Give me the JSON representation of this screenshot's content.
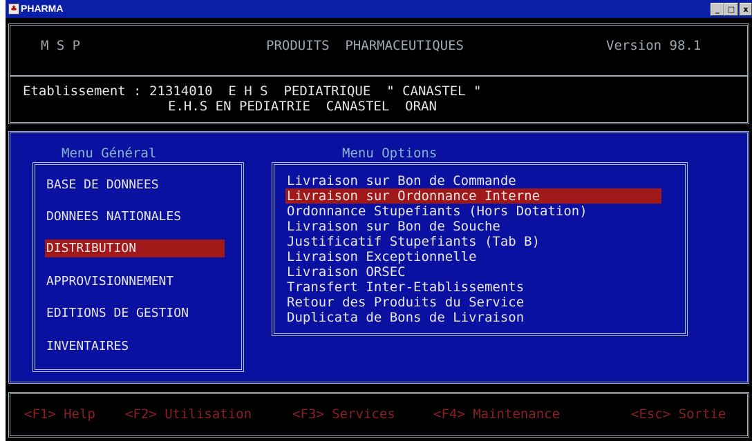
{
  "window": {
    "title": "PHARMA",
    "minimize": "_",
    "maximize": "□",
    "close": "x"
  },
  "header": {
    "org": "M S P",
    "product": "PRODUITS  PHARMACEUTIQUES",
    "version": "Version 98.1",
    "establishment_line1": "Etablissement : 21314010  E H S  PEDIATRIQUE  \" CANASTEL \"",
    "establishment_line2": "E.H.S EN PEDIATRIE  CANASTEL  ORAN"
  },
  "menu_general": {
    "title": "Menu Général",
    "items": [
      {
        "label": "BASE DE DONNEES",
        "selected": false
      },
      {
        "label": "DONNEES NATIONALES",
        "selected": false
      },
      {
        "label": "DISTRIBUTION",
        "selected": true
      },
      {
        "label": "APPROVISIONNEMENT",
        "selected": false
      },
      {
        "label": "EDITIONS DE GESTION",
        "selected": false
      },
      {
        "label": "INVENTAIRES",
        "selected": false
      }
    ]
  },
  "menu_options": {
    "title": "Menu Options",
    "items": [
      {
        "label": "Livraison sur Bon de Commande",
        "selected": false
      },
      {
        "label": "Livraison sur Ordonnance Interne",
        "selected": true
      },
      {
        "label": "Ordonnance Stupefiants (Hors Dotation)",
        "selected": false
      },
      {
        "label": "Livraison sur Bon de Souche",
        "selected": false
      },
      {
        "label": "Justificatif Stupefiants (Tab B)",
        "selected": false
      },
      {
        "label": "Livraison Exceptionnelle",
        "selected": false
      },
      {
        "label": "Livraison ORSEC",
        "selected": false
      },
      {
        "label": "Transfert Inter-Etablissements",
        "selected": false
      },
      {
        "label": "Retour des Produits du Service",
        "selected": false
      },
      {
        "label": "Duplicata de Bons de Livraison",
        "selected": false
      }
    ]
  },
  "footer": {
    "f1": "<F1> Help",
    "f2": "<F2> Utilisation",
    "f3": "<F3> Services",
    "f4": "<F4> Maintenance",
    "esc": "<Esc> Sortie"
  },
  "colors": {
    "title_bar": "#0a1fa8",
    "panel_blue": "#0a10a0",
    "highlight": "#a01818",
    "footer_text": "#8a2020"
  }
}
